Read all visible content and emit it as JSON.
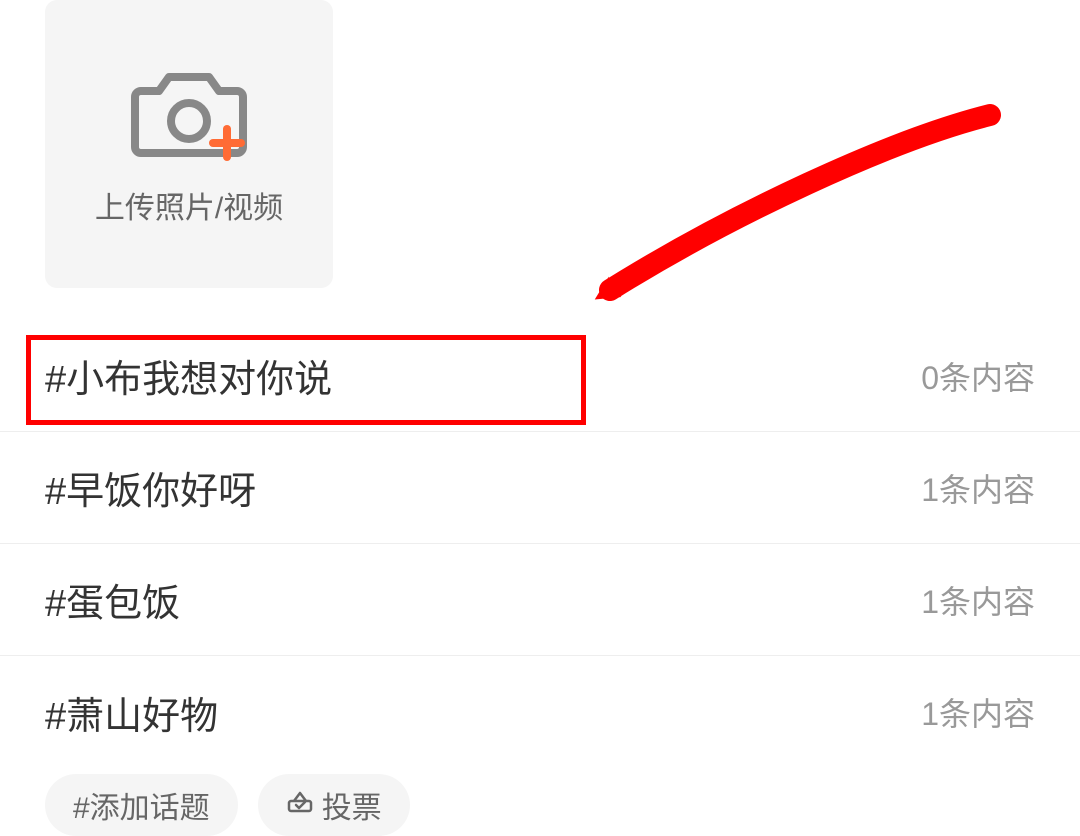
{
  "upload": {
    "label": "上传照片/视频"
  },
  "topics": [
    {
      "title": "#小布我想对你说",
      "count": "0条内容"
    },
    {
      "title": "#早饭你好呀",
      "count": "1条内容"
    },
    {
      "title": "#蛋包饭",
      "count": "1条内容"
    },
    {
      "title": "#萧山好物",
      "count": "1条内容"
    }
  ],
  "chips": {
    "add_topic": "#添加话题",
    "vote": "投票"
  },
  "annotation": {
    "highlight_index": 0
  }
}
